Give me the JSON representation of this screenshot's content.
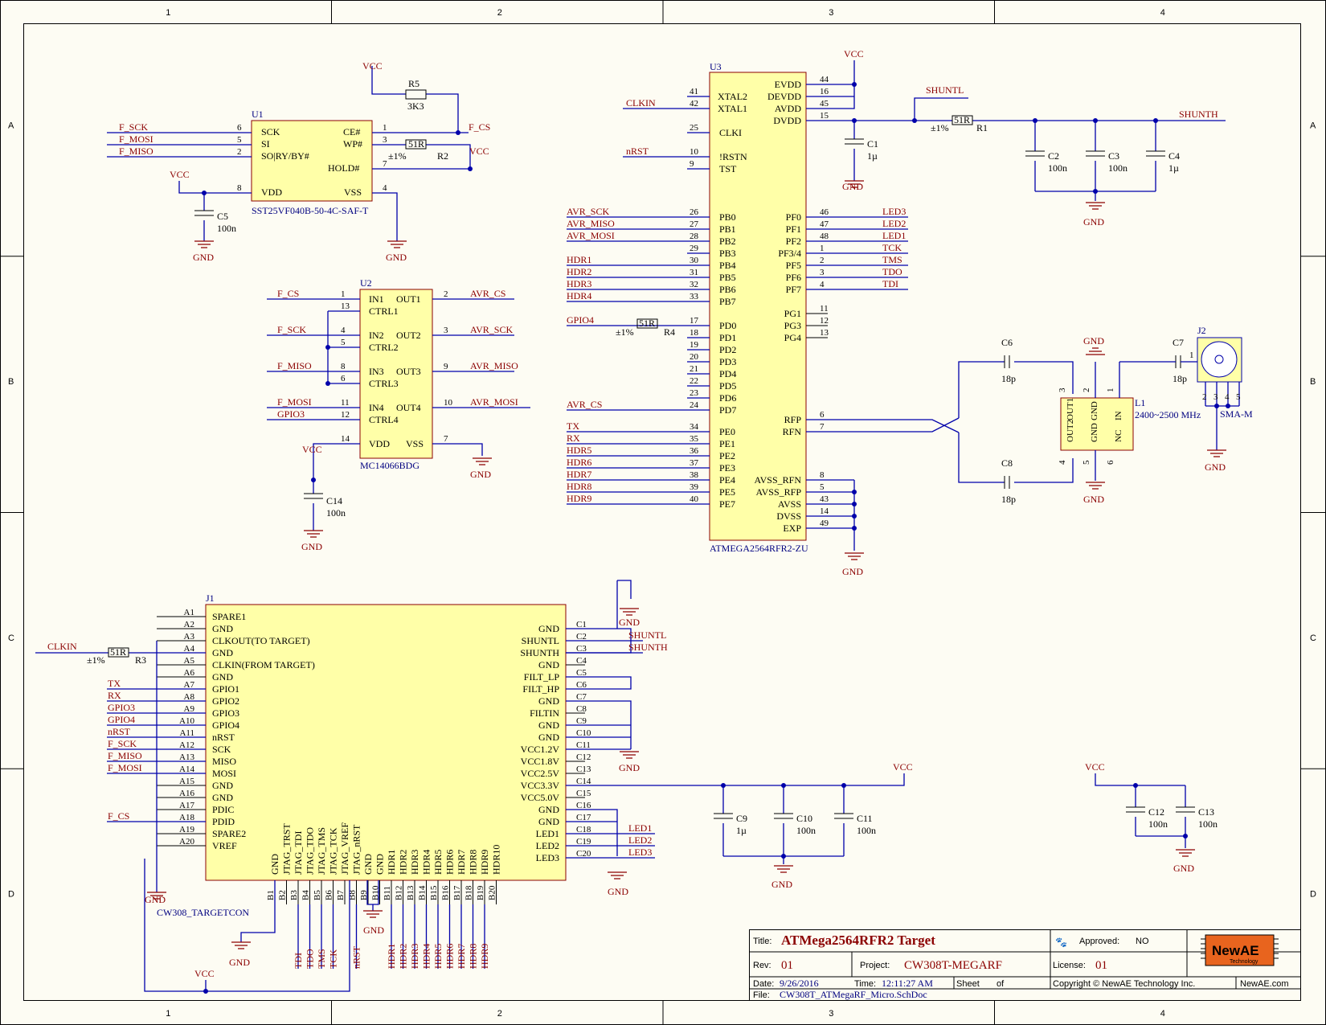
{
  "grid": {
    "columns": [
      "1",
      "2",
      "3",
      "4"
    ],
    "rows": [
      "A",
      "B",
      "C",
      "D"
    ]
  },
  "power_labels": {
    "vcc": "VCC",
    "gnd": "GND"
  },
  "u1": {
    "ref": "U1",
    "part": "SST25VF040B-50-4C-SAF-T",
    "left_pins": [
      {
        "name": "SCK",
        "num": "6",
        "net": "F_SCK"
      },
      {
        "name": "SI",
        "num": "5",
        "net": "F_MOSI"
      },
      {
        "name": "SO|RY/BY#",
        "num": "2",
        "net": "F_MISO"
      },
      {
        "name": "VDD",
        "num": "8",
        "net": ""
      }
    ],
    "right_pins": [
      {
        "name": "CE#",
        "num": "1",
        "net": "F_CS"
      },
      {
        "name": "WP#",
        "num": "3",
        "net": ""
      },
      {
        "name": "HOLD#",
        "num": "7",
        "net": ""
      },
      {
        "name": "VSS",
        "num": "4",
        "net": ""
      }
    ]
  },
  "r5": {
    "ref": "R5",
    "value": "3K3"
  },
  "r2": {
    "ref": "R2",
    "value": "51R",
    "tol": "±1%"
  },
  "c5": {
    "ref": "C5",
    "value": "100n"
  },
  "u2": {
    "ref": "U2",
    "part": "MC14066BDG",
    "left_pins": [
      {
        "name": "IN1",
        "num": "1",
        "net": "F_CS"
      },
      {
        "name": "CTRL1",
        "num": "13",
        "net": ""
      },
      {
        "name": "IN2",
        "num": "4",
        "net": "F_SCK"
      },
      {
        "name": "CTRL2",
        "num": "5",
        "net": ""
      },
      {
        "name": "IN3",
        "num": "8",
        "net": "F_MISO"
      },
      {
        "name": "CTRL3",
        "num": "6",
        "net": ""
      },
      {
        "name": "IN4",
        "num": "11",
        "net": "F_MOSI"
      },
      {
        "name": "CTRL4",
        "num": "12",
        "net": "GPIO3"
      },
      {
        "name": "VDD",
        "num": "14",
        "net": ""
      }
    ],
    "right_pins": [
      {
        "name": "OUT1",
        "num": "2",
        "net": "AVR_CS"
      },
      {
        "name": "OUT2",
        "num": "3",
        "net": "AVR_SCK"
      },
      {
        "name": "OUT3",
        "num": "9",
        "net": "AVR_MISO"
      },
      {
        "name": "OUT4",
        "num": "10",
        "net": "AVR_MOSI"
      },
      {
        "name": "VSS",
        "num": "7",
        "net": ""
      }
    ]
  },
  "c14": {
    "ref": "C14",
    "value": "100n"
  },
  "u3": {
    "ref": "U3",
    "part": "ATMEGA2564RFR2-ZU",
    "left_pins": [
      {
        "name": "XTAL2",
        "num": "41",
        "net": ""
      },
      {
        "name": "XTAL1",
        "num": "42",
        "net": "CLKIN"
      },
      {
        "name": "CLKI",
        "num": "25",
        "net": ""
      },
      {
        "name": "!RSTN",
        "num": "10",
        "net": "nRST"
      },
      {
        "name": "TST",
        "num": "9",
        "net": ""
      },
      {
        "name": "PB0",
        "num": "26",
        "net": "AVR_SCK"
      },
      {
        "name": "PB1",
        "num": "27",
        "net": "AVR_MISO"
      },
      {
        "name": "PB2",
        "num": "28",
        "net": "AVR_MOSI"
      },
      {
        "name": "PB3",
        "num": "29",
        "net": ""
      },
      {
        "name": "PB4",
        "num": "30",
        "net": "HDR1"
      },
      {
        "name": "PB5",
        "num": "31",
        "net": "HDR2"
      },
      {
        "name": "PB6",
        "num": "32",
        "net": "HDR3"
      },
      {
        "name": "PB7",
        "num": "33",
        "net": "HDR4"
      },
      {
        "name": "PD0",
        "num": "17",
        "net": "GPIO4"
      },
      {
        "name": "PD1",
        "num": "18",
        "net": ""
      },
      {
        "name": "PD2",
        "num": "19",
        "net": ""
      },
      {
        "name": "PD3",
        "num": "20",
        "net": ""
      },
      {
        "name": "PD4",
        "num": "21",
        "net": ""
      },
      {
        "name": "PD5",
        "num": "22",
        "net": ""
      },
      {
        "name": "PD6",
        "num": "23",
        "net": ""
      },
      {
        "name": "PD7",
        "num": "24",
        "net": "AVR_CS"
      },
      {
        "name": "PE0",
        "num": "34",
        "net": "TX"
      },
      {
        "name": "PE1",
        "num": "35",
        "net": "RX"
      },
      {
        "name": "PE2",
        "num": "36",
        "net": "HDR5"
      },
      {
        "name": "PE3",
        "num": "37",
        "net": "HDR6"
      },
      {
        "name": "PE4",
        "num": "38",
        "net": "HDR7"
      },
      {
        "name": "PE5",
        "num": "39",
        "net": "HDR8"
      },
      {
        "name": "PE7",
        "num": "40",
        "net": "HDR9"
      }
    ],
    "right_pins": [
      {
        "name": "EVDD",
        "num": "44"
      },
      {
        "name": "DEVDD",
        "num": "16"
      },
      {
        "name": "AVDD",
        "num": "45"
      },
      {
        "name": "DVDD",
        "num": "15"
      },
      {
        "name": "PF0",
        "num": "46",
        "net": "LED3"
      },
      {
        "name": "PF1",
        "num": "47",
        "net": "LED2"
      },
      {
        "name": "PF2",
        "num": "48",
        "net": "LED1"
      },
      {
        "name": "PF3/4",
        "num": "1",
        "net": "TCK"
      },
      {
        "name": "PF5",
        "num": "2",
        "net": "TMS"
      },
      {
        "name": "PF6",
        "num": "3",
        "net": "TDO"
      },
      {
        "name": "PF7",
        "num": "4",
        "net": "TDI"
      },
      {
        "name": "PG1",
        "num": "11"
      },
      {
        "name": "PG3",
        "num": "12"
      },
      {
        "name": "PG4",
        "num": "13"
      },
      {
        "name": "RFP",
        "num": "6"
      },
      {
        "name": "RFN",
        "num": "7"
      },
      {
        "name": "AVSS_RFN",
        "num": "8"
      },
      {
        "name": "AVSS_RFP",
        "num": "5"
      },
      {
        "name": "AVSS",
        "num": "43"
      },
      {
        "name": "DVSS",
        "num": "14"
      },
      {
        "name": "EXP",
        "num": "49"
      }
    ]
  },
  "r4": {
    "ref": "R4",
    "value": "51R",
    "tol": "±1%"
  },
  "r1": {
    "ref": "R1",
    "value": "51R",
    "tol": "±1%"
  },
  "shunt": {
    "l": "SHUNTL",
    "h": "SHUNTH"
  },
  "caps_top": [
    {
      "ref": "C1",
      "value": "1µ"
    },
    {
      "ref": "C2",
      "value": "100n"
    },
    {
      "ref": "C3",
      "value": "100n"
    },
    {
      "ref": "C4",
      "value": "1µ"
    }
  ],
  "rf": {
    "c6": {
      "ref": "C6",
      "value": "18p"
    },
    "c7": {
      "ref": "C7",
      "value": "18p"
    },
    "c8": {
      "ref": "C8",
      "value": "18p"
    },
    "l1": {
      "ref": "L1",
      "value": "2400~2500 MHz",
      "pins": [
        "OUT1",
        "GND",
        "IN",
        "OUT2",
        "GND",
        "NC"
      ],
      "nums": [
        "3",
        "2",
        "1",
        "4",
        "5",
        "6"
      ]
    },
    "j2": {
      "ref": "J2",
      "part": "SMA-M",
      "nums": [
        "1",
        "2",
        "3",
        "4",
        "5"
      ]
    }
  },
  "j1": {
    "ref": "J1",
    "part": "CW308_TARGETCON",
    "a_pins": [
      {
        "num": "A1",
        "name": "SPARE1",
        "net": ""
      },
      {
        "num": "A2",
        "name": "GND",
        "net": ""
      },
      {
        "num": "A3",
        "name": "CLKOUT(TO TARGET)",
        "net": "CLKIN"
      },
      {
        "num": "A4",
        "name": "GND",
        "net": ""
      },
      {
        "num": "A5",
        "name": "CLKIN(FROM TARGET)",
        "net": ""
      },
      {
        "num": "A6",
        "name": "GND",
        "net": ""
      },
      {
        "num": "A7",
        "name": "GPIO1",
        "net": "TX"
      },
      {
        "num": "A8",
        "name": "GPIO2",
        "net": "RX"
      },
      {
        "num": "A9",
        "name": "GPIO3",
        "net": "GPIO3"
      },
      {
        "num": "A10",
        "name": "GPIO4",
        "net": "GPIO4"
      },
      {
        "num": "A11",
        "name": "nRST",
        "net": "nRST"
      },
      {
        "num": "A12",
        "name": "SCK",
        "net": "F_SCK"
      },
      {
        "num": "A13",
        "name": "MISO",
        "net": "F_MISO"
      },
      {
        "num": "A14",
        "name": "MOSI",
        "net": "F_MOSI"
      },
      {
        "num": "A15",
        "name": "GND",
        "net": ""
      },
      {
        "num": "A16",
        "name": "GND",
        "net": ""
      },
      {
        "num": "A17",
        "name": "PDIC",
        "net": ""
      },
      {
        "num": "A18",
        "name": "PDID",
        "net": "F_CS"
      },
      {
        "num": "A19",
        "name": "SPARE2",
        "net": ""
      },
      {
        "num": "A20",
        "name": "VREF",
        "net": ""
      }
    ],
    "c_pins": [
      {
        "num": "C1",
        "name": "GND",
        "net": ""
      },
      {
        "num": "C2",
        "name": "SHUNTL",
        "net": "SHUNTL"
      },
      {
        "num": "C3",
        "name": "SHUNTH",
        "net": "SHUNTH"
      },
      {
        "num": "C4",
        "name": "GND",
        "net": ""
      },
      {
        "num": "C5",
        "name": "FILT_LP",
        "net": ""
      },
      {
        "num": "C6",
        "name": "FILT_HP",
        "net": ""
      },
      {
        "num": "C7",
        "name": "GND",
        "net": ""
      },
      {
        "num": "C8",
        "name": "FILTIN",
        "net": ""
      },
      {
        "num": "C9",
        "name": "GND",
        "net": ""
      },
      {
        "num": "C10",
        "name": "GND",
        "net": ""
      },
      {
        "num": "C11",
        "name": "VCC1.2V",
        "net": ""
      },
      {
        "num": "C12",
        "name": "VCC1.8V",
        "net": ""
      },
      {
        "num": "C13",
        "name": "VCC2.5V",
        "net": ""
      },
      {
        "num": "C14",
        "name": "VCC3.3V",
        "net": ""
      },
      {
        "num": "C15",
        "name": "VCC5.0V",
        "net": ""
      },
      {
        "num": "C16",
        "name": "GND",
        "net": ""
      },
      {
        "num": "C17",
        "name": "GND",
        "net": ""
      },
      {
        "num": "C18",
        "name": "LED1",
        "net": "LED1"
      },
      {
        "num": "C19",
        "name": "LED2",
        "net": "LED2"
      },
      {
        "num": "C20",
        "name": "LED3",
        "net": "LED3"
      }
    ],
    "b_pins": [
      {
        "num": "B1",
        "name": "GND",
        "net": ""
      },
      {
        "num": "B2",
        "name": "JTAG_TRST",
        "net": ""
      },
      {
        "num": "B3",
        "name": "JTAG_TDI",
        "net": "TDI"
      },
      {
        "num": "B4",
        "name": "JTAG_TDO",
        "net": "TDO"
      },
      {
        "num": "B5",
        "name": "JTAG_TMS",
        "net": "TMS"
      },
      {
        "num": "B6",
        "name": "JTAG_TCK",
        "net": "TCK"
      },
      {
        "num": "B7",
        "name": "JTAG_VREF",
        "net": ""
      },
      {
        "num": "B8",
        "name": "JTAG_nRST",
        "net": "nRST"
      },
      {
        "num": "B9",
        "name": "GND",
        "net": ""
      },
      {
        "num": "B10",
        "name": "GND",
        "net": ""
      },
      {
        "num": "B11",
        "name": "HDR1",
        "net": "HDR1"
      },
      {
        "num": "B12",
        "name": "HDR2",
        "net": "HDR2"
      },
      {
        "num": "B13",
        "name": "HDR3",
        "net": "HDR3"
      },
      {
        "num": "B14",
        "name": "HDR4",
        "net": "HDR4"
      },
      {
        "num": "B15",
        "name": "HDR5",
        "net": "HDR5"
      },
      {
        "num": "B16",
        "name": "HDR6",
        "net": "HDR6"
      },
      {
        "num": "B17",
        "name": "HDR7",
        "net": "HDR7"
      },
      {
        "num": "B18",
        "name": "HDR8",
        "net": "HDR8"
      },
      {
        "num": "B19",
        "name": "HDR9",
        "net": "HDR9"
      },
      {
        "num": "B20",
        "name": "HDR10",
        "net": ""
      }
    ]
  },
  "r3": {
    "ref": "R3",
    "value": "51R",
    "tol": "±1%"
  },
  "caps_bottom": [
    {
      "ref": "C9",
      "value": "1µ"
    },
    {
      "ref": "C10",
      "value": "100n"
    },
    {
      "ref": "C11",
      "value": "100n"
    },
    {
      "ref": "C12",
      "value": "100n"
    },
    {
      "ref": "C13",
      "value": "100n"
    }
  ],
  "title_block": {
    "title_label": "Title:",
    "title": "ATMega2564RFR2 Target",
    "approved_label": "Approved:",
    "approved": "NO",
    "rev_label": "Rev:",
    "rev": "01",
    "project_label": "Project:",
    "project": "CW308T-MEGARF",
    "license_label": "License:",
    "license": "01",
    "date_label": "Date:",
    "date": "9/26/2016",
    "time_label": "Time:",
    "time": "12:11:27 AM",
    "sheet_label": "Sheet",
    "of_label": "of",
    "copyright": "Copyright © NewAE Technology Inc.",
    "site": "NewAE.com",
    "file_label": "File:",
    "file": "CW308T_ATMegaRF_Micro.SchDoc",
    "logo_main": "NewAE",
    "logo_sub": "Technology",
    "brand_color": "#e8641e"
  }
}
